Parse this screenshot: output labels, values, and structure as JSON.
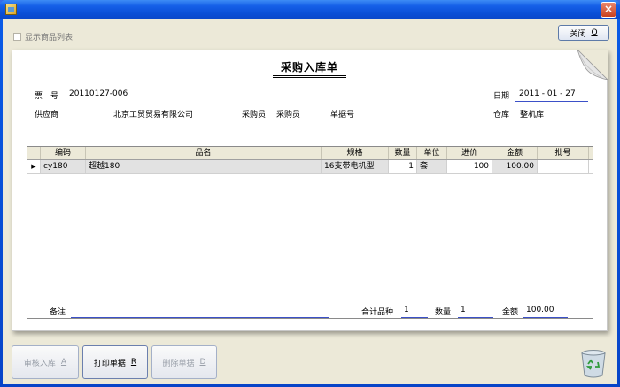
{
  "window": {
    "title": ""
  },
  "toolbar": {
    "show_list_label": "显示商品列表",
    "close_label": "关闭",
    "close_hotkey": "Q"
  },
  "header": {
    "title": "采购入库单",
    "ticket_label": "票　号",
    "ticket_no": "20110127-006",
    "date_label": "日期",
    "date_value": "2011 - 01 - 27",
    "supplier_label": "供应商",
    "supplier_value": "北京工贸贸易有限公司",
    "buyer_label": "采购员",
    "buyer_value": "采购员",
    "doc_no_label": "单据号",
    "doc_no_value": "",
    "warehouse_label": "仓库",
    "warehouse_value": "整机库"
  },
  "table": {
    "columns": [
      "编码",
      "品名",
      "规格",
      "数量",
      "单位",
      "进价",
      "金额",
      "批号"
    ],
    "rows": [
      {
        "code": "cy180",
        "name": "超越180",
        "spec": "16支带电机型",
        "qty": "1",
        "unit": "套",
        "price": "100",
        "amount": "100.00",
        "batch": ""
      }
    ]
  },
  "footer": {
    "remark_label": "备注",
    "remark_value": "",
    "total_kinds_label": "合计品种",
    "total_kinds_value": "1",
    "qty_label": "数量",
    "qty_value": "1",
    "amount_label": "金额",
    "amount_value": "100.00"
  },
  "actions": {
    "audit_label": "审核入库",
    "audit_hotkey": "A",
    "print_label": "打印单据",
    "print_hotkey": "R",
    "delete_label": "删除单据",
    "delete_hotkey": "D"
  },
  "icons": {
    "recycle": "recycle-bin-icon"
  }
}
